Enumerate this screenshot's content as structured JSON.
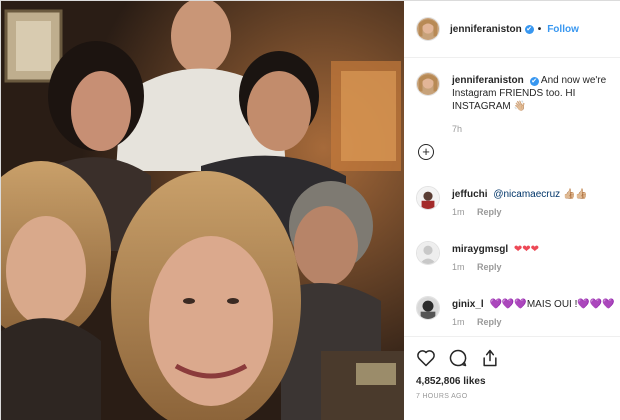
{
  "post": {
    "username": "jenniferaniston",
    "verified_badge": "✔",
    "follow_label": "Follow",
    "header_separator": "•"
  },
  "caption": {
    "username": "jenniferaniston",
    "text": "And now we're Instagram FRIENDS too. HI INSTAGRAM",
    "emoji": "👋🏼",
    "time": "7h"
  },
  "load_more_icon": "plus-circle-icon",
  "comments": [
    {
      "username": "jeffuchi",
      "mention": "@nicamaecruz",
      "text": "",
      "emoji": "👍🏼👍🏼",
      "time": "1m",
      "reply": "Reply"
    },
    {
      "username": "miraygmsgl",
      "mention": "",
      "text": "",
      "emoji": "❤❤❤",
      "time": "1m",
      "reply": "Reply"
    },
    {
      "username": "ginix_l",
      "mention": "",
      "text_before": "💜💜💜",
      "text": "MAIS OUI !",
      "emoji": "💜💜💜",
      "time": "1m",
      "reply": "Reply"
    }
  ],
  "actions": {
    "like_icon": "heart-icon",
    "comment_icon": "comment-icon",
    "share_icon": "share-icon"
  },
  "likes": "4,852,806 likes",
  "posted_ago": "7 HOURS AGO",
  "colors": {
    "accent": "#3897f0",
    "text": "#262626",
    "muted": "#999999",
    "heart": "#ed4956",
    "purple_heart": "#a07be6"
  }
}
